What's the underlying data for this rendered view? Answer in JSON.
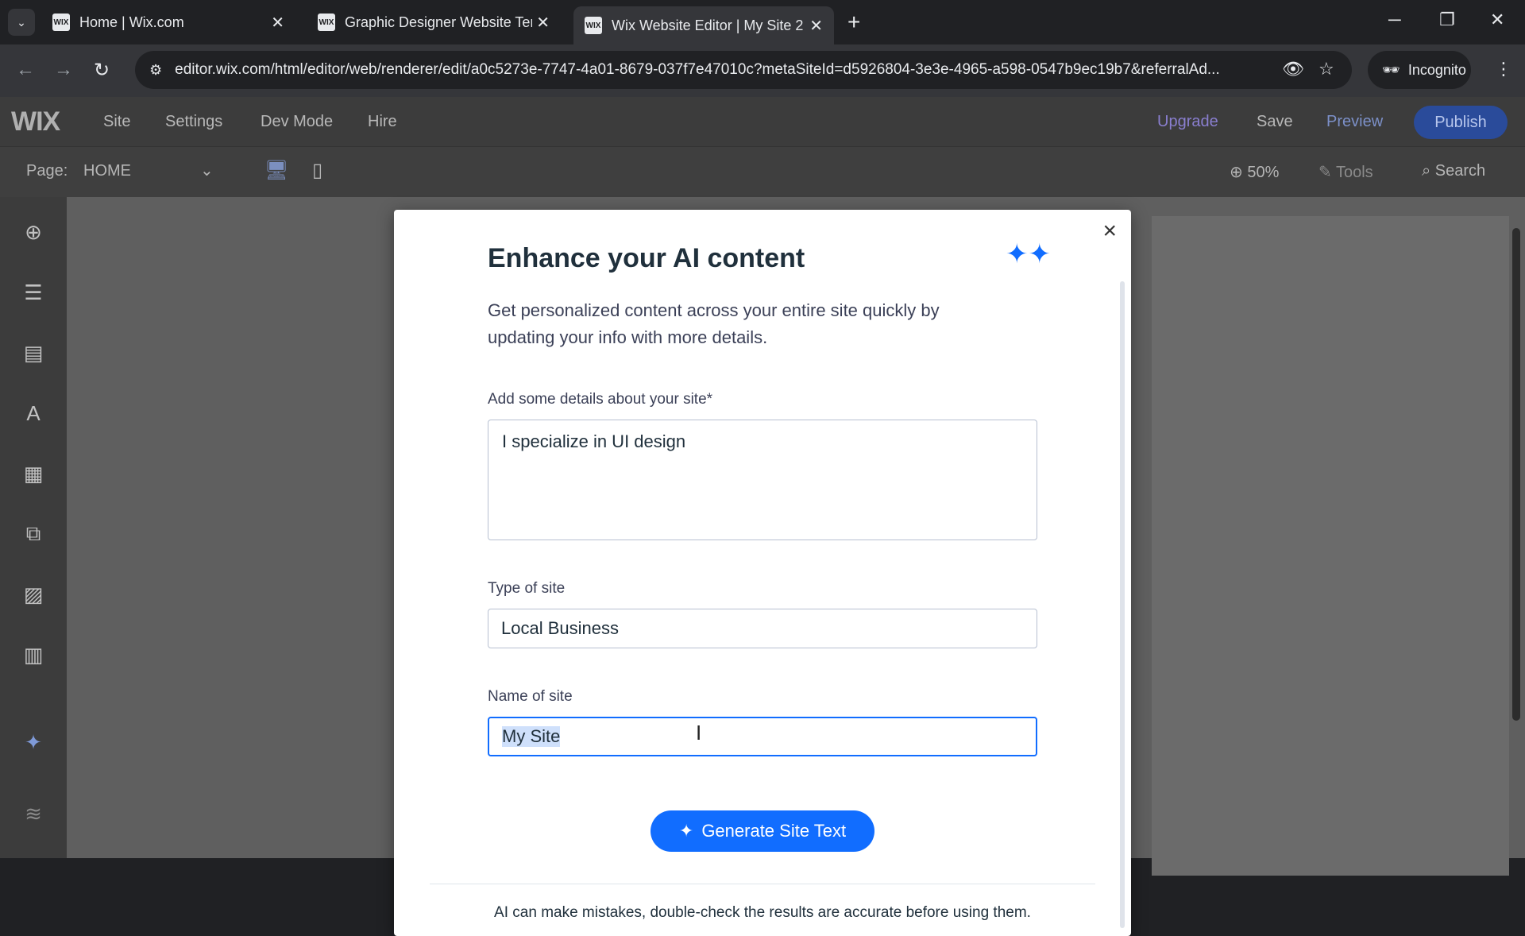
{
  "browser": {
    "tabs": [
      {
        "title": "Home | Wix.com",
        "favicon": "WIX",
        "active": false
      },
      {
        "title": "Graphic Designer Website Temp",
        "favicon": "WIX",
        "active": false
      },
      {
        "title": "Wix Website Editor | My Site 2",
        "favicon": "WIX",
        "active": true
      }
    ],
    "url": "editor.wix.com/html/editor/web/renderer/edit/a0c5273e-7747-4a01-8679-037f7e47010c?metaSiteId=d5926804-3e3e-4965-a598-0547b9ec19b7&referralAd...",
    "incognito_label": "Incognito"
  },
  "editor": {
    "logo": "WIX",
    "menu": [
      "Site",
      "Settings",
      "Dev Mode",
      "Hire"
    ],
    "upgrade": "Upgrade",
    "save": "Save",
    "preview": "Preview",
    "publish": "Publish",
    "page_label": "Page:",
    "page_value": "HOME",
    "zoom": "50%",
    "tools": "Tools",
    "search": "Search"
  },
  "modal": {
    "title": "Enhance your AI content",
    "description": "Get personalized content across your entire site quickly by updating your info with more details.",
    "details_label": "Add some details about your site*",
    "details_value": "I specialize in UI design",
    "type_label": "Type of site",
    "type_value": "Local Business",
    "name_label": "Name of site",
    "name_value": "My Site",
    "generate_button": "Generate Site Text",
    "footnote": "AI can make mistakes, double-check the results are accurate before using them."
  },
  "colors": {
    "accent": "#116dff",
    "chrome_bg": "#202124",
    "editor_bg": "#3c3c3c"
  }
}
